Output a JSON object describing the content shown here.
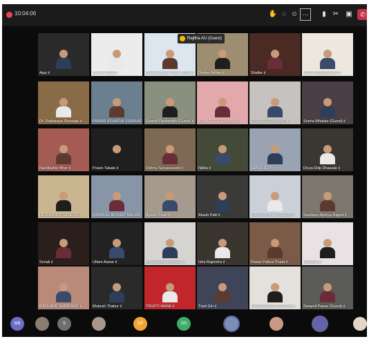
{
  "meeting": {
    "timer": "10:04:06"
  },
  "toolbar": {
    "icons": [
      "hand-icon",
      "chat-icon",
      "people-icon",
      "more-icon",
      "camera-icon",
      "mic-icon",
      "share-icon",
      "leave-icon"
    ],
    "more_label": "···"
  },
  "speaker": {
    "name": "Rajitha AU (Guest)"
  },
  "grid": {
    "rows": [
      [
        {
          "name": "Ajay",
          "bg": "#2a2a2a"
        },
        {
          "name": "Suresh Ghuli",
          "bg": "#ececec"
        },
        {
          "name": "Dnyaneshwar Pawar (Guest)",
          "bg": "#dde6ee"
        },
        {
          "name": "Omkar Adhav",
          "bg": "#9d8e72"
        },
        {
          "name": "Sheller",
          "bg": "#4a2a22"
        },
        {
          "name": "SHID SADANARAM",
          "bg": "#ece7df"
        }
      ],
      [
        {
          "name": "Dr. Dattatraya Shendge",
          "bg": "#8a6b48"
        },
        {
          "name": "PAWAR ATHARVA SHRAVAN",
          "bg": "#6c7f8f"
        },
        {
          "name": "Suresh Deshmukh (Guest)",
          "bg": "#8a8f80"
        },
        {
          "name": "ADVAIT GIRGUNKAR",
          "bg": "#e2a8ab"
        },
        {
          "name": "SURESH GAIKWAD",
          "bg": "#c5c2bf"
        },
        {
          "name": "Sneha Mhaske (Guest)",
          "bg": "#4a3f45"
        }
      ],
      [
        {
          "name": "Nandkishor Bhor",
          "bg": "#a35b54"
        },
        {
          "name": "Pravin Takale",
          "bg": "#1f1f1f"
        },
        {
          "name": "Vishnu Suryawanshi",
          "bg": "#7e6a54"
        },
        {
          "name": "Nikita",
          "bg": "#444a38"
        },
        {
          "name": "SANSKRUTI",
          "bg": "#9aa3b1"
        },
        {
          "name": "Divya Dilip Dhawale",
          "bg": "#3a3631"
        }
      ],
      [
        {
          "name": "DESHMUKH GANESH",
          "bg": "#c9b58f"
        },
        {
          "name": "KARAKAL AKSHAY MAHADEV",
          "bg": "#8895a6"
        },
        {
          "name": "Ayushi Shah",
          "bg": "#a59a8d"
        },
        {
          "name": "Akash Patil",
          "bg": "#3a3a38"
        },
        {
          "name": "Kalyani Kothule (Guest)",
          "bg": "#cbd0d8"
        },
        {
          "name": "Sandeep Ajinkya Rajput",
          "bg": "#7d7770"
        }
      ],
      [
        {
          "name": "Sonali",
          "bg": "#2b1f1c"
        },
        {
          "name": "Uttam Aswar",
          "bg": "#222"
        },
        {
          "name": "Bhagyashree Bondre",
          "bg": "#d6d4d1"
        },
        {
          "name": "Isha Rajendra",
          "bg": "#3b3530"
        },
        {
          "name": "Pawar Pallavi Popat",
          "bg": "#7b5a48"
        },
        {
          "name": "Hiladesh",
          "bg": "#e8e2e4"
        }
      ],
      [
        {
          "name": "GADHAVE SHRIRANG",
          "bg": "#b98a7a"
        },
        {
          "name": "Mukesh Thakur",
          "bg": "#2a2a2a"
        },
        {
          "name": "TRUPTI MANE",
          "bg": "#c0262b"
        },
        {
          "name": "Tripti Giri",
          "bg": "#3f4458"
        },
        {
          "name": "KHANDEKAR MUSKAN",
          "bg": "#e4e1dc"
        },
        {
          "name": "Swapnil Pawar (Guest)",
          "bg": "#5b5b57"
        }
      ]
    ]
  },
  "bottom_avatars": [
    {
      "label": "MB",
      "color": "#6b6fc7"
    },
    {
      "label": "",
      "color": "#8a7d70"
    },
    {
      "label": "S",
      "color": "#6f6f6f"
    },
    {
      "label": "",
      "color": "#a8968a"
    },
    {
      "label": "DP",
      "color": "#f2a534"
    },
    {
      "label": "SS",
      "color": "#3fae6a"
    },
    {
      "label": "",
      "color": "#7a8fb5"
    },
    {
      "label": "",
      "color": "#c99a86"
    },
    {
      "label": "",
      "color": "#6264a7"
    },
    {
      "label": "",
      "color": "#e4d6c6"
    }
  ]
}
